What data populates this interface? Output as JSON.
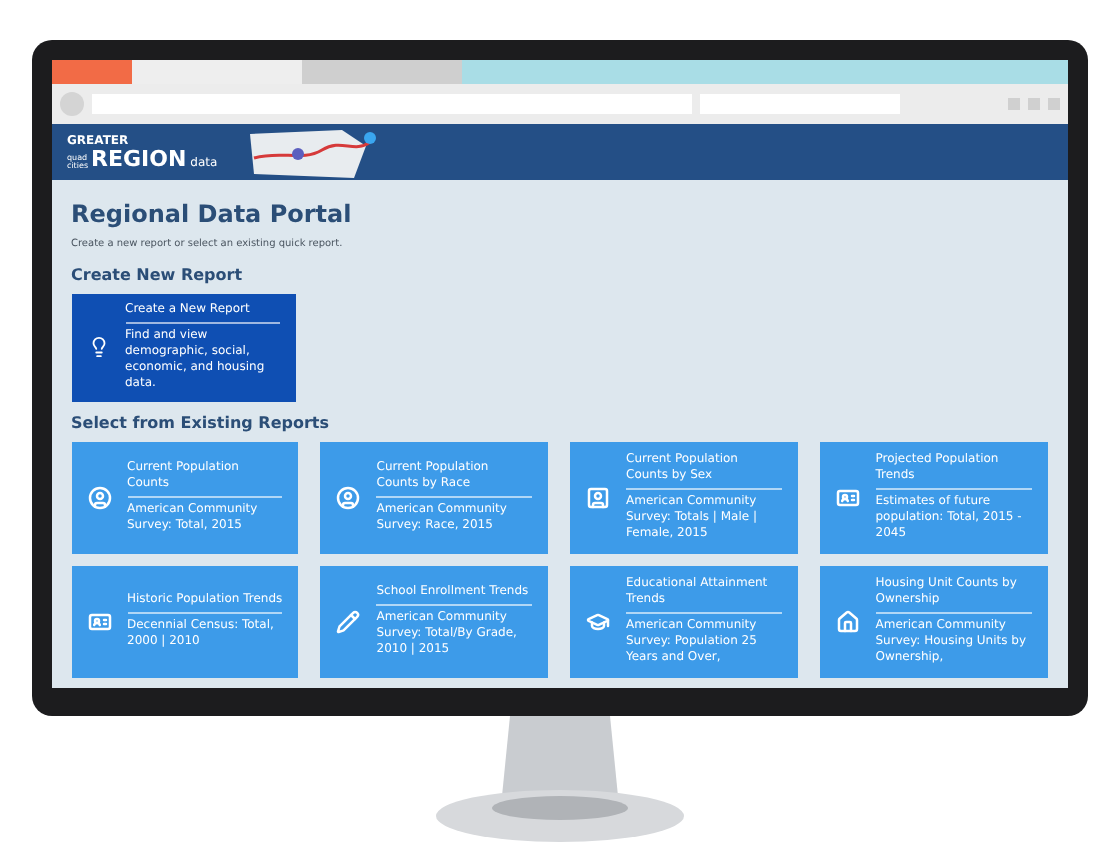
{
  "header": {
    "logo": {
      "top": "GREATER",
      "small": "quad cities",
      "main": "REGION",
      "suffix": "data"
    }
  },
  "page": {
    "title": "Regional Data Portal",
    "subtitle": "Create a new report or select an existing quick report."
  },
  "create_section": {
    "heading": "Create New Report",
    "tile": {
      "title": "Create a New Report",
      "description": "Find and view demographic, social, economic, and housing data."
    }
  },
  "existing_section": {
    "heading": "Select from Existing Reports",
    "reports": [
      {
        "kind": "person",
        "title": "Current Population Counts",
        "description": "American Community Survey: Total, 2015"
      },
      {
        "kind": "person",
        "title": "Current Population Counts by Race",
        "description": "American Community Survey: Race, 2015"
      },
      {
        "kind": "badge",
        "title": "Current Population Counts by Sex",
        "description": "American Community Survey: Totals | Male | Female, 2015"
      },
      {
        "kind": "card",
        "title": "Projected Population Trends",
        "description": "Estimates of future population: Total, 2015 - 2045"
      },
      {
        "kind": "card",
        "title": "Historic Population Trends",
        "description": "Decennial Census: Total, 2000 | 2010"
      },
      {
        "kind": "pencil",
        "title": "School Enrollment Trends",
        "description": "American Community Survey: Total/By Grade, 2010 | 2015"
      },
      {
        "kind": "cap",
        "title": "Educational Attainment Trends",
        "description": "American Community Survey: Population 25 Years and Over,"
      },
      {
        "kind": "house",
        "title": "Housing Unit Counts by Ownership",
        "description": "American Community Survey: Housing Units by Ownership,"
      }
    ]
  }
}
